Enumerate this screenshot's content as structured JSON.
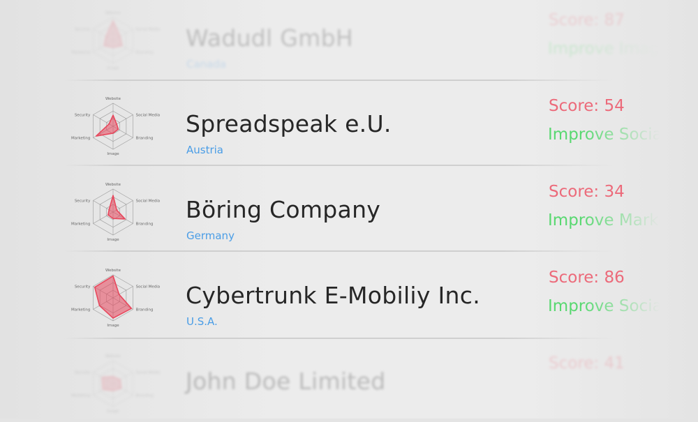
{
  "radar_axes": [
    "Website",
    "Social Media",
    "Branding",
    "Image",
    "Marketing",
    "Security"
  ],
  "colors": {
    "accent": "#e8475c",
    "country": "#4a9de6",
    "score": "#ec6a7a",
    "improve": "#58d870"
  },
  "companies": [
    {
      "name": "Wadudl GmbH",
      "country": "Canada",
      "score_label": "Score: 87",
      "improve_label": "Improve Image",
      "radar": [
        0.85,
        0.35,
        0.45,
        0.3,
        0.45,
        0.35
      ]
    },
    {
      "name": "Spreadspeak e.U.",
      "country": "Austria",
      "score_label": "Score: 54",
      "improve_label": "Improve Social Media",
      "radar": [
        0.48,
        0.18,
        0.26,
        0.3,
        0.85,
        0.2
      ]
    },
    {
      "name": "Böring Company",
      "country": "Germany",
      "score_label": "Score: 34",
      "improve_label": "Improve Marketing",
      "radar": [
        0.72,
        0.18,
        0.6,
        0.28,
        0.25,
        0.2
      ]
    },
    {
      "name": "Cybertrunk E-Mobiliy Inc.",
      "country": "U.S.A.",
      "score_label": "Score: 86",
      "improve_label": "Improve Social Media",
      "radar": [
        0.95,
        0.3,
        0.92,
        0.88,
        0.68,
        0.92
      ]
    },
    {
      "name": "John Doe Limited",
      "country": "",
      "score_label": "Score: 41",
      "improve_label": "",
      "radar": [
        0.3,
        0.35,
        0.4,
        0.3,
        0.5,
        0.55
      ]
    }
  ]
}
